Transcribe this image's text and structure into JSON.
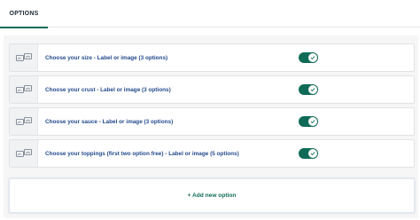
{
  "tabs": [
    {
      "label": "OPTIONS",
      "active": true
    }
  ],
  "options": [
    {
      "name": "Choose your size",
      "separator": " - ",
      "detail": "Label or image (3 options)",
      "enabled": true,
      "icon": "image-placeholder-icon"
    },
    {
      "name": "Choose your crust",
      "separator": " - ",
      "detail": "Label or image (3 options)",
      "enabled": true,
      "icon": "image-placeholder-icon"
    },
    {
      "name": "Choose your sauce",
      "separator": " - ",
      "detail": "Label or image (3 options)",
      "enabled": true,
      "icon": "image-placeholder-icon"
    },
    {
      "name": "Choose your toppings (first two option free)",
      "separator": " - ",
      "detail": "Label or image (5 options)",
      "enabled": true,
      "icon": "image-placeholder-icon"
    }
  ],
  "add_option": {
    "label": "+ Add new option"
  },
  "colors": {
    "accent": "#0f6b57",
    "link": "#234a8d",
    "panel_bg": "#f6f6f7"
  }
}
